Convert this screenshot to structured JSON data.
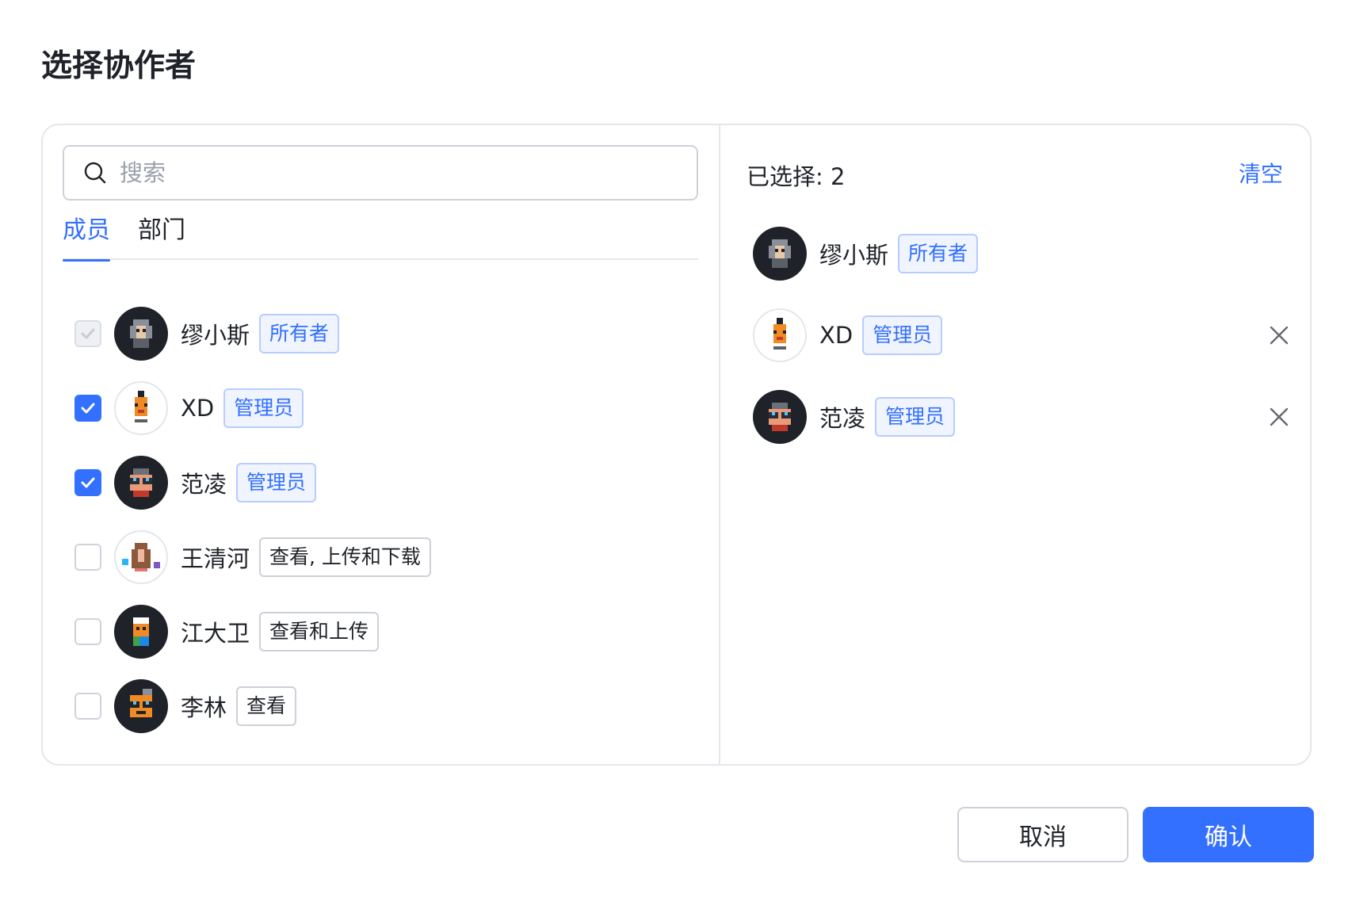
{
  "dialog": {
    "title": "选择协作者"
  },
  "search": {
    "placeholder": "搜索"
  },
  "tabs": [
    {
      "label": "成员",
      "active": true
    },
    {
      "label": "部门",
      "active": false
    }
  ],
  "members": [
    {
      "name": "缪小斯",
      "role": "所有者",
      "role_style": "blue",
      "checked": true,
      "disabled": true,
      "avatar": "pixel-avatar-grey-hood"
    },
    {
      "name": "XD",
      "role": "管理员",
      "role_style": "blue",
      "checked": true,
      "disabled": false,
      "avatar": "pixel-avatar-orange-bottle"
    },
    {
      "name": "范凌",
      "role": "管理员",
      "role_style": "blue",
      "checked": true,
      "disabled": false,
      "avatar": "pixel-avatar-red-glasses"
    },
    {
      "name": "王清河",
      "role": "查看, 上传和下载",
      "role_style": "gray",
      "checked": false,
      "disabled": false,
      "avatar": "pixel-avatar-longhair"
    },
    {
      "name": "江大卫",
      "role": "查看和上传",
      "role_style": "gray",
      "checked": false,
      "disabled": false,
      "avatar": "pixel-avatar-pirate"
    },
    {
      "name": "李林",
      "role": "查看",
      "role_style": "gray",
      "checked": false,
      "disabled": false,
      "avatar": "pixel-avatar-orange-glasses"
    }
  ],
  "selected": {
    "label": "已选择: 2",
    "clear_label": "清空",
    "items": [
      {
        "name": "缪小斯",
        "role": "所有者",
        "removable": false
      },
      {
        "name": "XD",
        "role": "管理员",
        "removable": true
      },
      {
        "name": "范凌",
        "role": "管理员",
        "removable": true
      }
    ]
  },
  "footer": {
    "cancel_label": "取消",
    "confirm_label": "确认"
  },
  "colors": {
    "accent": "#3370ff",
    "border": "#e4e6eb",
    "text": "#1f2329",
    "placeholder": "#9aa0aa"
  }
}
